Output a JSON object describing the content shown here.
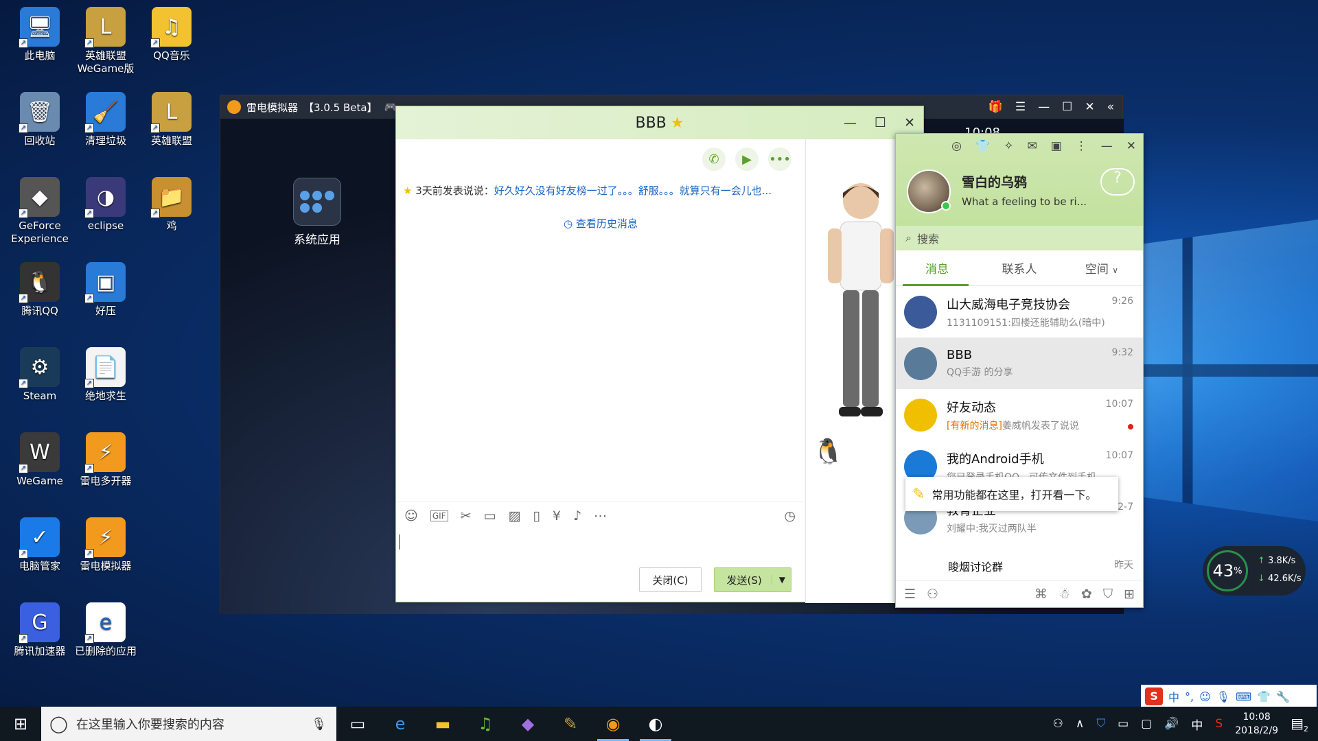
{
  "desktop": {
    "icons": [
      {
        "label": "此电脑",
        "glyph": "🖥"
      },
      {
        "label": "英雄联盟WeGame版",
        "glyph": "L"
      },
      {
        "label": "QQ音乐",
        "glyph": "♫"
      },
      {
        "label": "回收站",
        "glyph": "🗑"
      },
      {
        "label": "清理垃圾",
        "glyph": "🧹"
      },
      {
        "label": "英雄联盟",
        "glyph": "L"
      },
      {
        "label": "GeForce Experience",
        "glyph": "◆"
      },
      {
        "label": "eclipse",
        "glyph": "◑"
      },
      {
        "label": "鸡",
        "glyph": "📁"
      },
      {
        "label": "腾讯QQ",
        "glyph": "🐧"
      },
      {
        "label": "好压",
        "glyph": "▣"
      },
      {
        "label": "Steam",
        "glyph": "⚙"
      },
      {
        "label": "绝地求生",
        "glyph": "📄"
      },
      {
        "label": "WeGame",
        "glyph": "W"
      },
      {
        "label": "雷电多开器",
        "glyph": "⚡"
      },
      {
        "label": "电脑管家",
        "glyph": "✓"
      },
      {
        "label": "雷电模拟器",
        "glyph": "⚡"
      },
      {
        "label": "腾讯加速器",
        "glyph": "G"
      },
      {
        "label": "已删除的应用",
        "glyph": "e"
      }
    ]
  },
  "emulator": {
    "title": "雷电模拟器",
    "version": "【3.0.5 Beta】",
    "time": "10:08",
    "app_label": "系统应用"
  },
  "chat": {
    "title": "BBB",
    "mood_prefix": "3天前发表说说：",
    "mood_text": "好久好久没有好友榜一过了。。。舒服。。。就算只有一会儿也...",
    "history_link": "查看历史消息",
    "close_button": "关闭(C)",
    "send_button": "发送(S)"
  },
  "qq": {
    "nickname": "雪白的乌鸦",
    "signature": "What a feeling to be ri...",
    "search_placeholder": "搜索",
    "tabs": [
      "消息",
      "联系人",
      "空间"
    ],
    "contacts": [
      {
        "name": "教育企业",
        "preview": "刘耀中:我灭过两队半",
        "time": "2-7",
        "color": "#7a9ab8"
      },
      {
        "name": "我的Android手机",
        "preview": "您已登录手机QQ，可传文件到手机",
        "time": "10:07",
        "color": "#1a7ad8"
      },
      {
        "name": "好友动态",
        "preview_tag": "[有新的消息]",
        "preview": "姜威帆发表了说说",
        "time": "10:07",
        "color": "#f0c000"
      },
      {
        "name": "BBB",
        "preview": "QQ手游 的分享",
        "time": "9:32",
        "color": "#5a7a9a"
      },
      {
        "name": "山大威海电子竞技协会",
        "preview": "1131109151:四楼还能辅助么(暗中)",
        "time": "9:26",
        "color": "#3a5a9a"
      }
    ],
    "tip_text": "常用功能都在这里，打开看一下。",
    "partial_row": {
      "name": "睃烟讨论群",
      "time": "昨天"
    }
  },
  "net": {
    "percent": "43",
    "pct_sign": "%",
    "up": "3.8K/s",
    "down": "42.6K/s"
  },
  "taskbar": {
    "search_placeholder": "在这里输入你要搜索的内容",
    "time": "10:08",
    "date": "2018/2/9",
    "ime": "中",
    "notif_count": "2"
  }
}
